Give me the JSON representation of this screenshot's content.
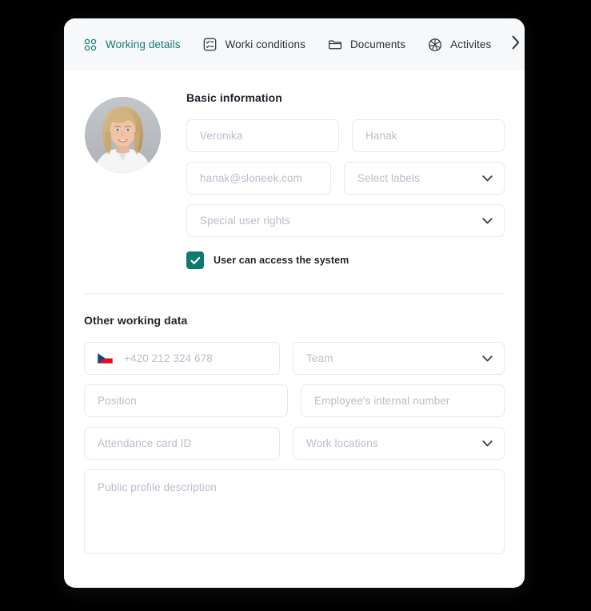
{
  "card": {
    "tabs": [
      {
        "label": "Working details",
        "icon": "grid-dots-icon",
        "active": true
      },
      {
        "label": "Worki conditions",
        "icon": "checklist-icon",
        "active": false
      },
      {
        "label": "Documents",
        "icon": "folder-icon",
        "active": false
      },
      {
        "label": "Activites",
        "icon": "ball-icon",
        "active": false
      }
    ],
    "next_arrow_icon": "chevron-right-icon"
  },
  "basic": {
    "title": "Basic information",
    "avatar_alt": "user-avatar-photo",
    "first_name": {
      "placeholder": "Veronika",
      "value": ""
    },
    "last_name": {
      "placeholder": "Hanak",
      "value": ""
    },
    "email": {
      "placeholder": "hanak@sloneek.com",
      "value": ""
    },
    "labels": {
      "placeholder": "Select labels",
      "value": ""
    },
    "special_rights": {
      "placeholder": "Special user rights",
      "value": ""
    },
    "access_checkbox": {
      "label": "User can access the system",
      "checked": true
    }
  },
  "other": {
    "title": "Other working data",
    "phone": {
      "placeholder": "+420 212 324 678",
      "value": "",
      "country_flag": "czech-republic-flag"
    },
    "team": {
      "placeholder": "Team",
      "value": ""
    },
    "position": {
      "placeholder": "Position",
      "value": ""
    },
    "internal_number": {
      "placeholder": "Employee's internal number",
      "value": ""
    },
    "attendance_card": {
      "placeholder": "Attendance card ID",
      "value": ""
    },
    "work_locations": {
      "placeholder": "Work locations",
      "value": ""
    },
    "description": {
      "placeholder": "Public profile description",
      "value": ""
    }
  },
  "colors": {
    "accent": "#0e7d72",
    "checkbox": "#0e7a6e",
    "placeholder": "#b9bec9",
    "border": "#e6e9f0",
    "tabbar_bg": "#f7f8fa",
    "page_bg": "#000000",
    "card_bg": "#ffffff"
  }
}
